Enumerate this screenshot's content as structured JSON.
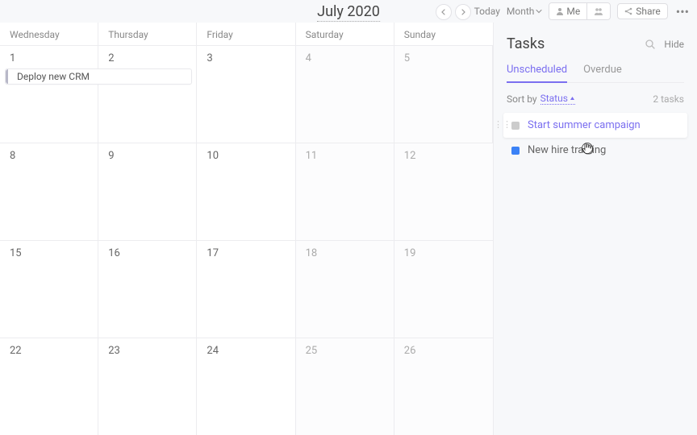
{
  "header": {
    "title": "July 2020",
    "today_label": "Today",
    "view_label": "Month",
    "me_label": "Me",
    "share_label": "Share"
  },
  "calendar": {
    "day_names": [
      "Wednesday",
      "Thursday",
      "Friday",
      "Saturday",
      "Sunday"
    ],
    "weekend_flags": [
      false,
      false,
      false,
      true,
      true
    ],
    "weeks": [
      [
        "1",
        "2",
        "3",
        "4",
        "5"
      ],
      [
        "8",
        "9",
        "10",
        "11",
        "12"
      ],
      [
        "15",
        "16",
        "17",
        "18",
        "19"
      ],
      [
        "22",
        "23",
        "24",
        "25",
        "26"
      ]
    ],
    "events": [
      {
        "week": 0,
        "col_start": 0,
        "col_span": 2,
        "label": "Deploy new CRM"
      }
    ]
  },
  "tasks": {
    "title": "Tasks",
    "hide_label": "Hide",
    "tabs": [
      {
        "label": "Unscheduled",
        "active": true
      },
      {
        "label": "Overdue",
        "active": false
      }
    ],
    "sort_prefix": "Sort by",
    "sort_value": "Status",
    "count_num": "2",
    "count_suffix": "tasks",
    "items": [
      {
        "label": "Start summer campaign",
        "status": "gray",
        "linked": true,
        "hovered": true
      },
      {
        "label": "New hire training",
        "status": "blue",
        "linked": false,
        "hovered": false
      }
    ]
  }
}
